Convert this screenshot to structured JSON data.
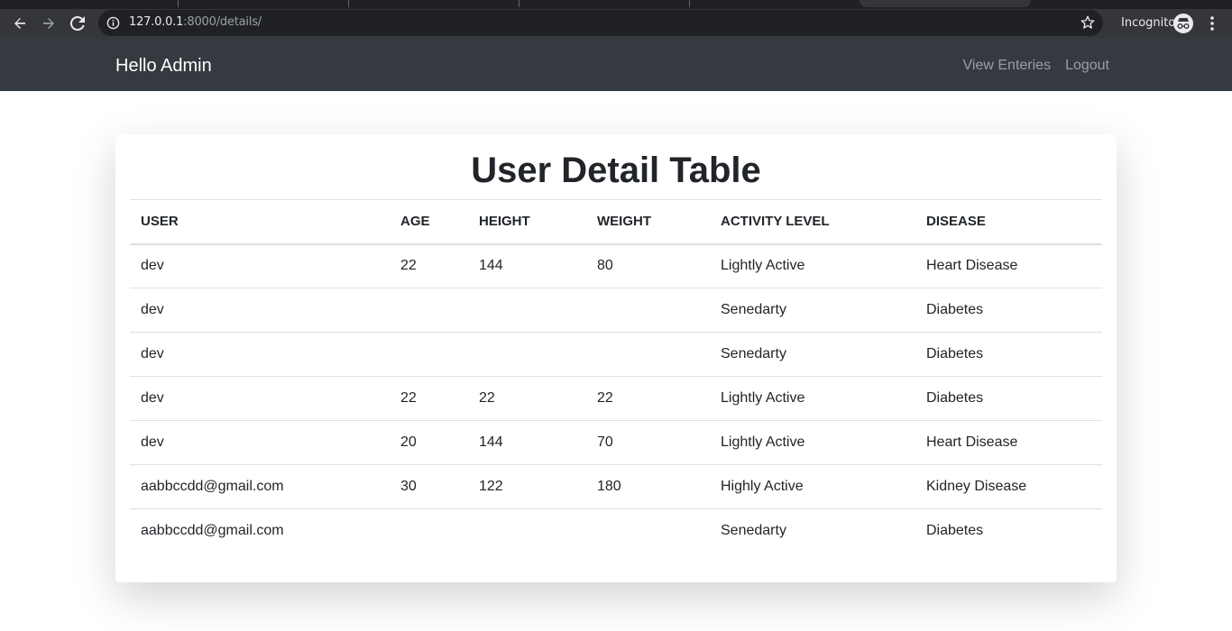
{
  "browser": {
    "url_host": "127.0.0.1",
    "url_rest": ":8000/details/",
    "incognito_label": "Incognito"
  },
  "navbar": {
    "brand": "Hello Admin",
    "links": [
      "View Enteries",
      "Logout"
    ]
  },
  "page": {
    "title": "User Detail Table",
    "columns": [
      "USER",
      "AGE",
      "HEIGHT",
      "WEIGHT",
      "ACTIVITY LEVEL",
      "DISEASE"
    ],
    "rows": [
      [
        "dev",
        "22",
        "144",
        "80",
        "Lightly Active",
        "Heart Disease"
      ],
      [
        "dev",
        "",
        "",
        "",
        "Senedarty",
        "Diabetes"
      ],
      [
        "dev",
        "",
        "",
        "",
        "Senedarty",
        "Diabetes"
      ],
      [
        "dev",
        "22",
        "22",
        "22",
        "Lightly Active",
        "Diabetes"
      ],
      [
        "dev",
        "20",
        "144",
        "70",
        "Lightly Active",
        "Heart Disease"
      ],
      [
        "aabbccdd@gmail.com",
        "30",
        "122",
        "180",
        "Highly Active",
        "Kidney Disease"
      ],
      [
        "aabbccdd@gmail.com",
        "",
        "",
        "",
        "Senedarty",
        "Diabetes"
      ]
    ]
  },
  "icons": {
    "back": "arrow-left-icon",
    "forward": "arrow-right-icon",
    "reload": "reload-icon",
    "info": "info-icon",
    "bookmark": "star-icon",
    "incognito": "incognito-icon",
    "menu": "kebab-menu-icon"
  },
  "colors": {
    "navbar_bg": "#343a40",
    "chrome_bg": "#35363a",
    "text": "#212529",
    "border": "#dee2e6"
  }
}
